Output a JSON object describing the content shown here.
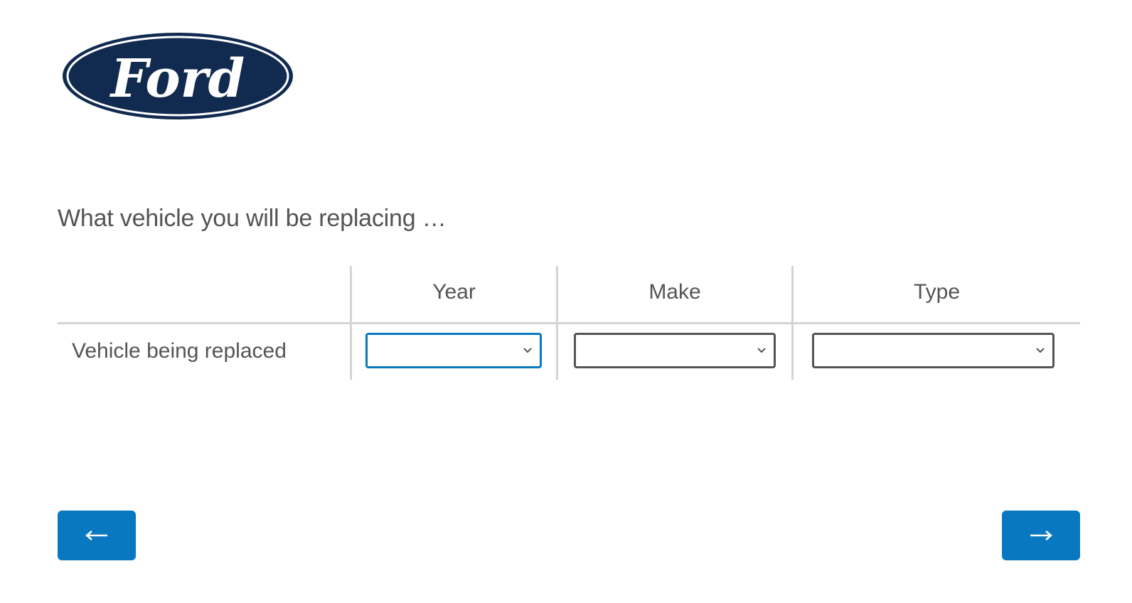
{
  "brand": {
    "logo_text": "Ford",
    "logo_color": "#112a50"
  },
  "question": {
    "text": "What vehicle you will be replacing …"
  },
  "matrix": {
    "columns": [
      "Year",
      "Make",
      "Type"
    ],
    "rows": [
      {
        "label": "Vehicle being replaced",
        "selects": [
          {
            "column": "Year",
            "value": "",
            "focused": true
          },
          {
            "column": "Make",
            "value": "",
            "focused": false
          },
          {
            "column": "Type",
            "value": "",
            "focused": false
          }
        ]
      }
    ]
  },
  "navigation": {
    "back_icon": "arrow-left-icon",
    "next_icon": "arrow-right-icon",
    "accent_color": "#0a78c0"
  }
}
